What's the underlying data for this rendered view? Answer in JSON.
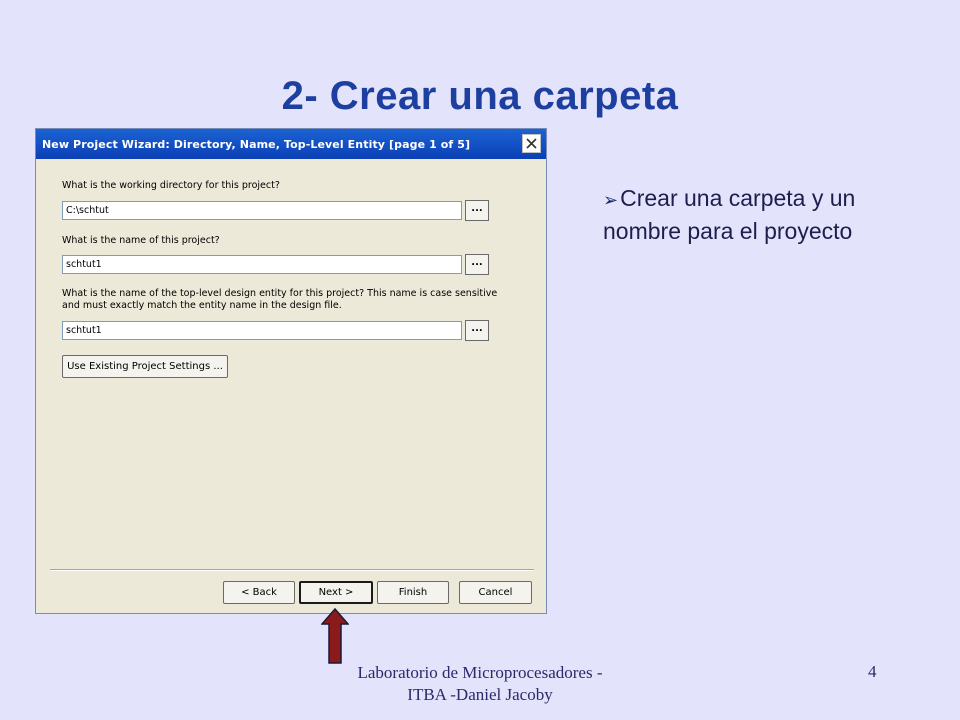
{
  "slide": {
    "title": "2- Crear una carpeta",
    "bullet_symbol": "➢",
    "bullet_text": "Crear una carpeta y un nombre para el proyecto",
    "footer_line1": "Laboratorio de Microprocesadores -",
    "footer_line2": "ITBA -Daniel Jacoby",
    "page_number": "4"
  },
  "dialog": {
    "title": "New Project Wizard: Directory, Name, Top-Level Entity [page 1 of 5]",
    "close_icon": "close-icon",
    "fields": [
      {
        "label": "What is the working directory for this project?",
        "value": "C:\\schtut",
        "browse": "..."
      },
      {
        "label": "What is the name of this project?",
        "value": "schtut1",
        "browse": "..."
      },
      {
        "label_line1": "What is the name of the top-level design entity for this project? This name is case sensitive",
        "label_line2": "and must exactly match the entity name in the design file.",
        "value": "schtut1",
        "browse": "..."
      }
    ],
    "existing_settings_label": "Use Existing Project Settings ...",
    "buttons": {
      "back": "< Back",
      "next": "Next >",
      "finish": "Finish",
      "cancel": "Cancel"
    }
  },
  "colors": {
    "slide_bg": "#e3e3fb",
    "title_color": "#1c3fa0",
    "titlebar_blue": "#0c3fb5",
    "arrow_fill": "#8b1a1a"
  }
}
